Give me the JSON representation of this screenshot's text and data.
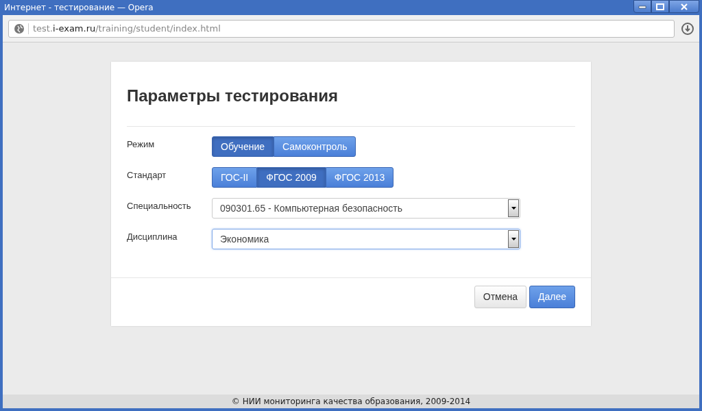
{
  "window": {
    "title": "Интернет - тестирование — Opera"
  },
  "address_bar": {
    "subdomain": "test.",
    "domain": "i-exam.ru",
    "path": "/training/student/index.html"
  },
  "form": {
    "title": "Параметры тестирования",
    "fields": [
      {
        "kind": "toggle",
        "label": "Режим",
        "options": [
          {
            "label": "Обучение",
            "selected": true
          },
          {
            "label": "Самоконтроль",
            "selected": false
          }
        ]
      },
      {
        "kind": "toggle",
        "label": "Стандарт",
        "options": [
          {
            "label": "ГОС-II",
            "selected": false
          },
          {
            "label": "ФГОС 2009",
            "selected": true
          },
          {
            "label": "ФГОС 2013",
            "selected": false
          }
        ]
      },
      {
        "kind": "select",
        "label": "Специальность",
        "value": "090301.65 - Компьютерная безопасность",
        "focused": false
      },
      {
        "kind": "select",
        "label": "Дисциплина",
        "value": "Экономика",
        "focused": true
      }
    ],
    "buttons": [
      {
        "kind": "secondary",
        "label": "Отмена"
      },
      {
        "kind": "primary",
        "label": "Далее"
      }
    ]
  },
  "footer": {
    "text": "© НИИ мониторинга качества образования, 2009-2014"
  }
}
